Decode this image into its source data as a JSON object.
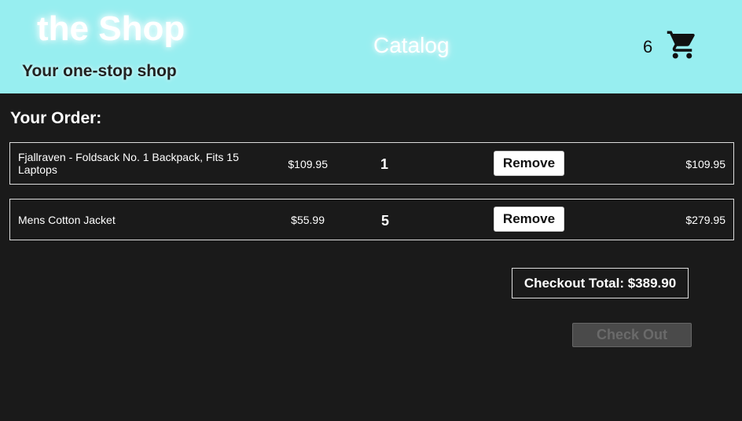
{
  "header": {
    "brand_title": "the Shop",
    "tagline": "Your one-stop shop",
    "nav_catalog": "Catalog",
    "cart_count": "6",
    "cart_icon": "shopping-cart-icon",
    "colors": {
      "header_bg": "#97eef0",
      "page_bg": "#1a1a1a"
    }
  },
  "order": {
    "heading": "Your Order:",
    "items": [
      {
        "name": "Fjallraven - Foldsack No. 1 Backpack, Fits 15 Laptops",
        "price": "$109.95",
        "quantity": "1",
        "remove_label": "Remove",
        "subtotal": "$109.95"
      },
      {
        "name": "Mens Cotton Jacket",
        "price": "$55.99",
        "quantity": "5",
        "remove_label": "Remove",
        "subtotal": "$279.95"
      }
    ],
    "checkout_total": "Checkout Total: $389.90",
    "checkout_button": "Check Out"
  }
}
